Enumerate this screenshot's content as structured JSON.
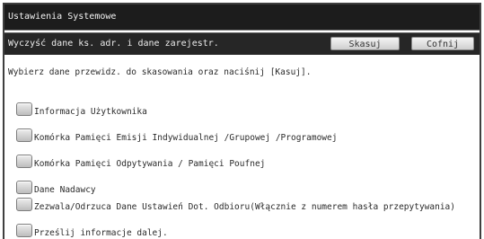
{
  "window": {
    "title": "Ustawienia Systemowe"
  },
  "header": {
    "label": "Wyczyść dane ks. adr. i dane zarejestr.",
    "delete_label": "Skasuj",
    "back_label": "Cofnij"
  },
  "instruction": "Wybierz dane przewidz. do skasowania oraz naciśnij [Kasuj].",
  "options": [
    {
      "label": "Informacja Użytkownika",
      "checked": false
    },
    {
      "label": "Komórka Pamięci Emisji Indywidualnej /Grupowej /Programowej",
      "checked": false
    },
    {
      "label": "Komórka Pamięci Odpytywania / Pamięci Poufnej",
      "checked": false
    },
    {
      "label": "Dane Nadawcy",
      "checked": false
    },
    {
      "label": "Zezwala/Odrzuca Dane Ustawień Dot. Odbioru(Włącznie z numerem hasła przepytywania)",
      "checked": false
    },
    {
      "label": "Prześlij informacje dalej.",
      "checked": false
    }
  ]
}
